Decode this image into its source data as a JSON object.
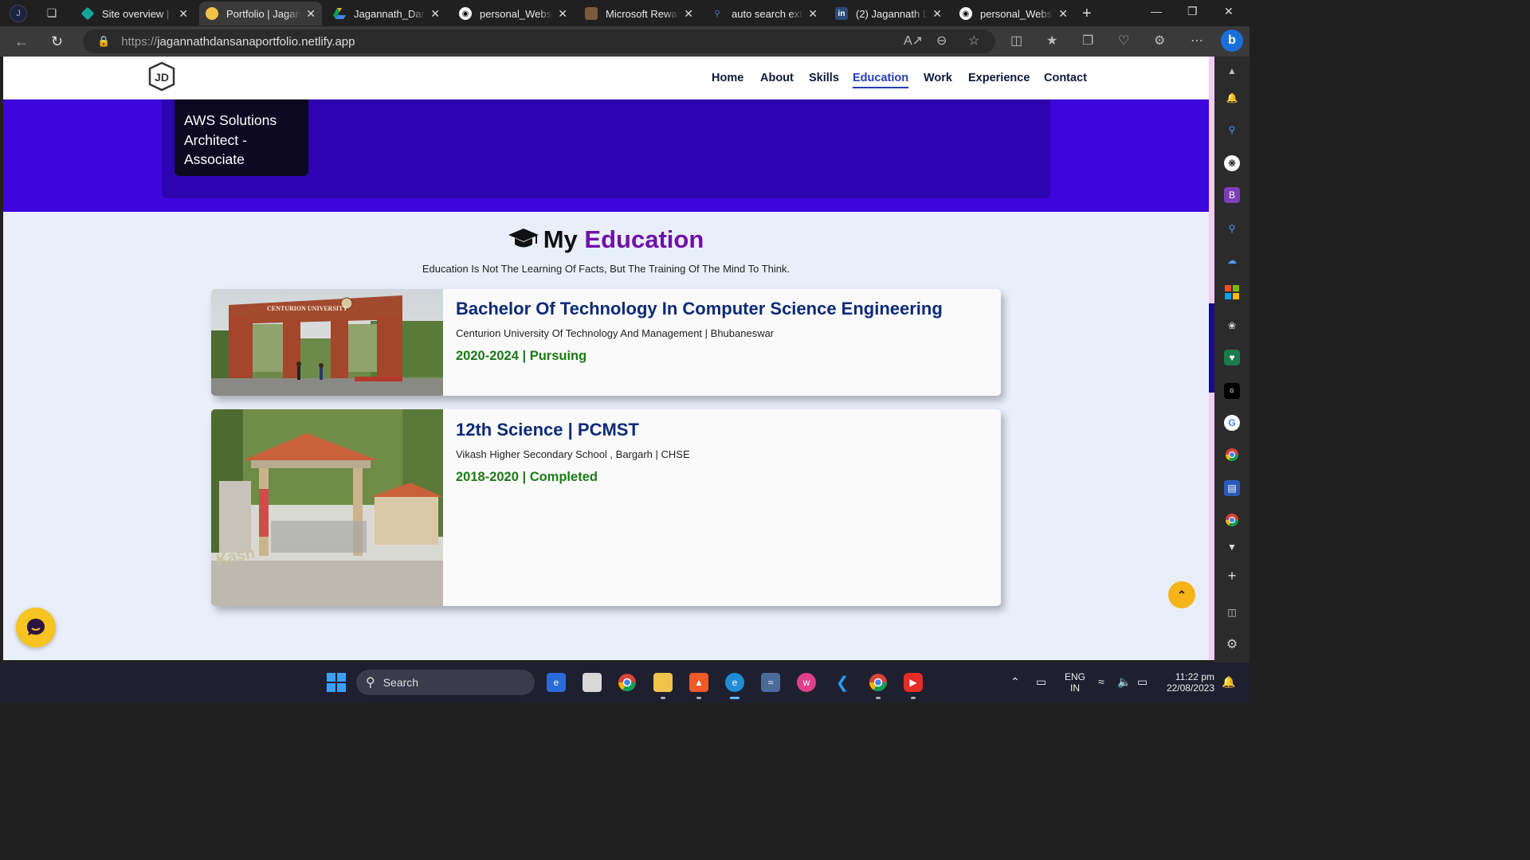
{
  "browser": {
    "tabs": [
      {
        "title": "Site overview | ja",
        "active": false
      },
      {
        "title": "Portfolio | Jaganr",
        "active": true
      },
      {
        "title": "Jagannath_Dansa",
        "active": false
      },
      {
        "title": "personal_Website",
        "active": false
      },
      {
        "title": "Microsoft Rewar",
        "active": false
      },
      {
        "title": "auto search exte",
        "active": false
      },
      {
        "title": "(2) Jagannath Da",
        "active": false
      },
      {
        "title": "personal_Website",
        "active": false
      }
    ],
    "url_scheme": "https://",
    "url_host": "jagannathdansanaportfolio.netlify.app"
  },
  "site": {
    "logo_text": "JD",
    "nav": [
      {
        "label": "Home",
        "active": false
      },
      {
        "label": "About",
        "active": false
      },
      {
        "label": "Skills",
        "active": false
      },
      {
        "label": "Education",
        "active": true
      },
      {
        "label": "Work",
        "active": false
      },
      {
        "label": "Experience",
        "active": false
      },
      {
        "label": "Contact",
        "active": false
      }
    ],
    "certification_card": {
      "line1": "AWS Solutions",
      "line2": "Architect -",
      "line3": "Associate"
    },
    "education": {
      "heading_prefix": "My",
      "heading_accent": "Education",
      "subtitle": "Education Is Not The Learning Of Facts, But The Training Of The Mind To Think.",
      "items": [
        {
          "title": "Bachelor Of Technology In Computer Science Engineering",
          "institution": "Centurion University Of Technology And Management | Bhubaneswar",
          "dates": "2020-2024 | Pursuing",
          "image_sign": "CENTURION UNIVERSITY"
        },
        {
          "title": "12th Science | PCMST",
          "institution": "Vikash Higher Secondary School , Bargarh | CHSE",
          "dates": "2018-2020 | Completed",
          "image_sign": "Kash"
        }
      ]
    }
  },
  "taskbar": {
    "search_label": "Search",
    "language_line1": "ENG",
    "language_line2": "IN",
    "time": "11:22 pm",
    "date": "22/08/2023"
  },
  "colors": {
    "accent_purple": "#7010a8",
    "band_purple": "#3d06dc",
    "title_navy": "#0c2a78",
    "date_green": "#1c7a16",
    "nav_active": "#1f3fb8"
  }
}
